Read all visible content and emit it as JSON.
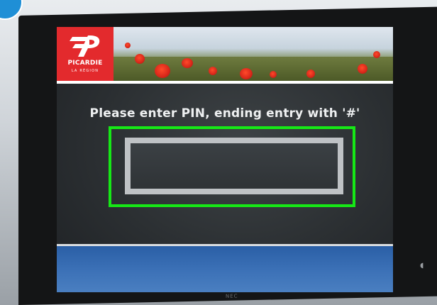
{
  "logo": {
    "name": "PICARDIE",
    "sub": "LA RÉGION"
  },
  "prompt": {
    "text": "Please enter PIN, ending entry with '#'"
  },
  "pin_field": {
    "value": ""
  },
  "monitor": {
    "brand": "NEC"
  },
  "colors": {
    "logo_red": "#e32a2d",
    "highlight_green": "#16e816",
    "bottom_bar_blue": "#3b70b6"
  }
}
